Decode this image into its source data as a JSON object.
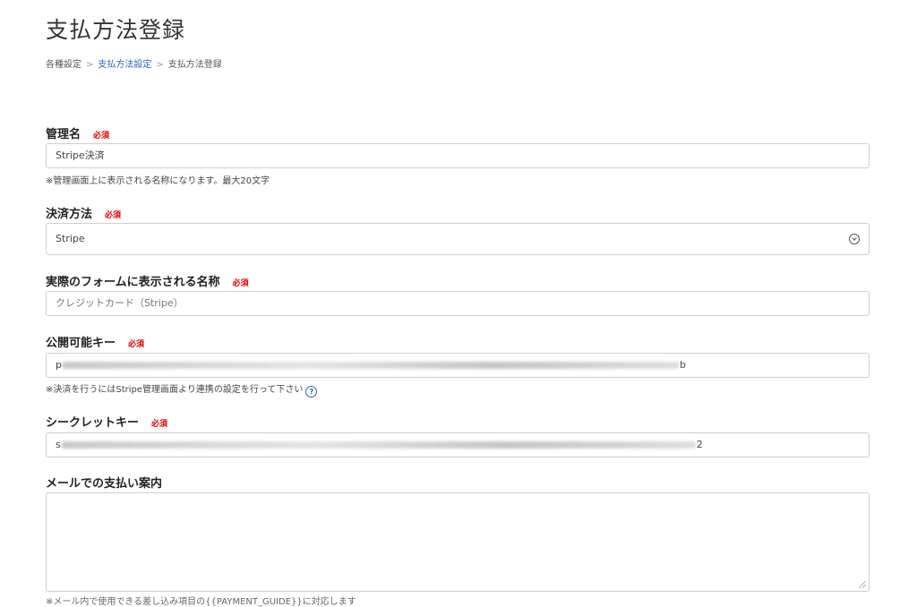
{
  "page": {
    "title": "支払方法登録"
  },
  "breadcrumb": {
    "items": [
      "各種設定",
      "支払方法設定",
      "支払方法登録"
    ],
    "separator": ">"
  },
  "form": {
    "required_label": "必須",
    "admin_name": {
      "label": "管理名",
      "value": "Stripe決済",
      "help": "※管理画面上に表示される名称になります。最大20文字"
    },
    "payment_method": {
      "label": "決済方法",
      "selected": "Stripe"
    },
    "display_name": {
      "label": "実際のフォームに表示される名称",
      "placeholder": "クレジットカード（Stripe）"
    },
    "public_key": {
      "label": "公開可能キー",
      "value_prefix": "p",
      "value_suffix": "b",
      "help": "※決済を行うにはStripe管理画面より連携の設定を行って下さい"
    },
    "secret_key": {
      "label": "シークレットキー",
      "value_prefix": "s",
      "value_suffix": "2"
    },
    "mail_guide": {
      "label": "メールでの支払い案内",
      "note": "※メール内で使用できる差し込み項目の{{PAYMENT_GUIDE}}に対応します"
    }
  },
  "colors": {
    "link": "#2a63b8",
    "required": "#e00000"
  }
}
